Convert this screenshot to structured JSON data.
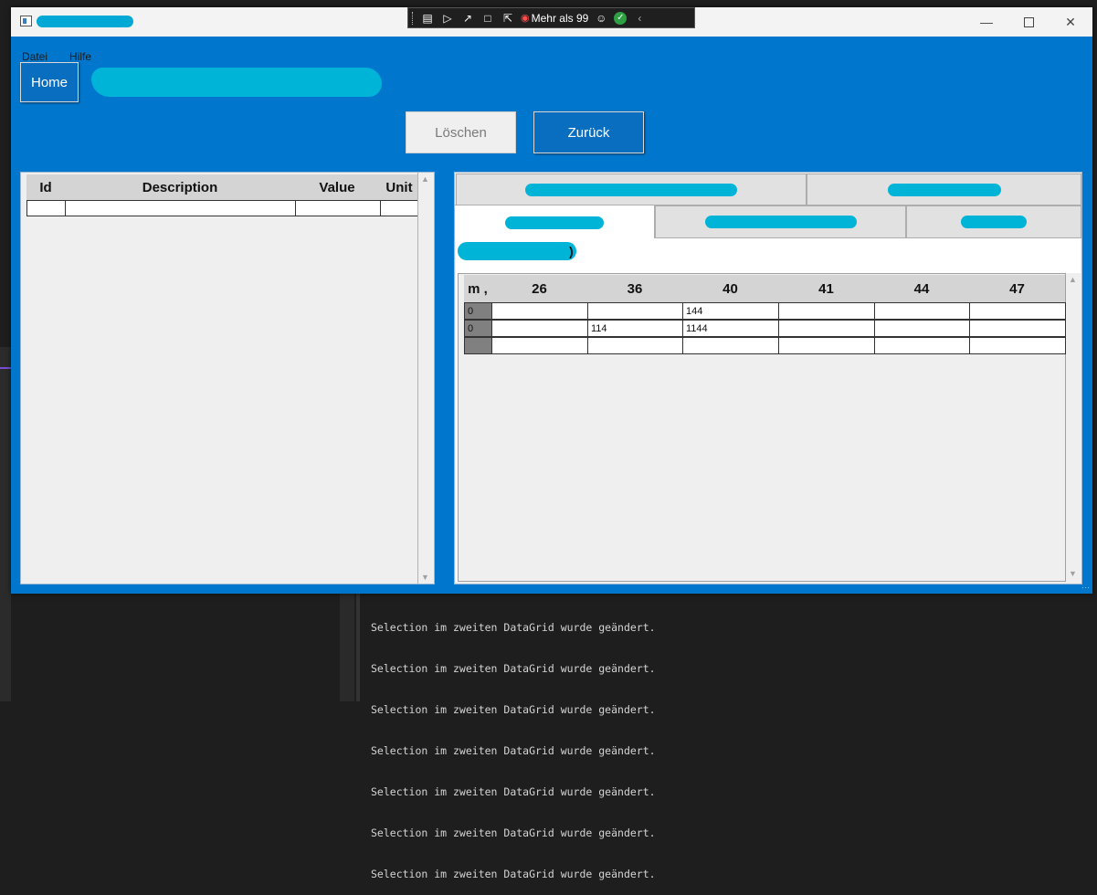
{
  "menu": {
    "file": "Datei",
    "help": "Hilfe"
  },
  "debug_toolbar": {
    "count_label": "Mehr als 99"
  },
  "buttons": {
    "home": "Home",
    "delete": "Löschen",
    "back": "Zurück"
  },
  "left_grid": {
    "columns": [
      "Id",
      "Description",
      "Value",
      "Unit"
    ]
  },
  "right_grid": {
    "columns": [
      "m ,",
      "26",
      "36",
      "40",
      "41",
      "44",
      "47"
    ],
    "rows": [
      {
        "header": "0",
        "cells": [
          "",
          "",
          "144",
          "",
          "",
          ""
        ]
      },
      {
        "header": "0",
        "cells": [
          "",
          "114",
          "1144",
          "",
          "",
          ""
        ]
      },
      {
        "header": "",
        "cells": [
          "",
          "",
          "",
          "",
          "",
          ""
        ]
      }
    ]
  },
  "inner_label_suffix": ")",
  "console": {
    "lines": [
      "Selection im zweiten DataGrid wurde geändert.",
      "Selection im zweiten DataGrid wurde geändert.",
      "Selection im zweiten DataGrid wurde geändert.",
      "Selection im zweiten DataGrid wurde geändert.",
      "Selection im zweiten DataGrid wurde geändert.",
      "Selection im zweiten DataGrid wurde geändert.",
      "Selection im zweiten DataGrid wurde geändert."
    ]
  }
}
